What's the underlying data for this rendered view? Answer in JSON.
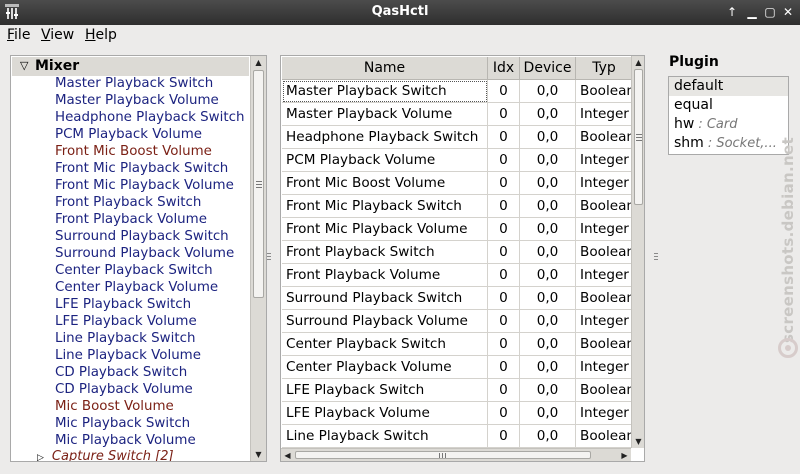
{
  "window": {
    "title": "QasHctl"
  },
  "menu": [
    {
      "mnemonic": "F",
      "rest": "ile"
    },
    {
      "mnemonic": "V",
      "rest": "iew"
    },
    {
      "mnemonic": "H",
      "rest": "elp"
    }
  ],
  "tree": {
    "root_label": "Mixer",
    "items": [
      {
        "label": "Master Playback Switch",
        "red": false
      },
      {
        "label": "Master Playback Volume",
        "red": false
      },
      {
        "label": "Headphone Playback Switch",
        "red": false
      },
      {
        "label": "PCM Playback Volume",
        "red": false
      },
      {
        "label": "Front Mic Boost Volume",
        "red": true
      },
      {
        "label": "Front Mic Playback Switch",
        "red": false
      },
      {
        "label": "Front Mic Playback Volume",
        "red": false
      },
      {
        "label": "Front Playback Switch",
        "red": false
      },
      {
        "label": "Front Playback Volume",
        "red": false
      },
      {
        "label": "Surround Playback Switch",
        "red": false
      },
      {
        "label": "Surround Playback Volume",
        "red": false
      },
      {
        "label": "Center Playback Switch",
        "red": false
      },
      {
        "label": "Center Playback Volume",
        "red": false
      },
      {
        "label": "LFE Playback Switch",
        "red": false
      },
      {
        "label": "LFE Playback Volume",
        "red": false
      },
      {
        "label": "Line Playback Switch",
        "red": false
      },
      {
        "label": "Line Playback Volume",
        "red": false
      },
      {
        "label": "CD Playback Switch",
        "red": false
      },
      {
        "label": "CD Playback Volume",
        "red": false
      },
      {
        "label": "Mic Boost Volume",
        "red": true
      },
      {
        "label": "Mic Playback Switch",
        "red": false
      },
      {
        "label": "Mic Playback Volume",
        "red": false
      }
    ],
    "collapsed_item": "Capture Switch [2]"
  },
  "table": {
    "headers": {
      "name": "Name",
      "idx": "Idx",
      "device": "Device",
      "type": "Typ"
    },
    "rows": [
      {
        "name": "Master Playback Switch",
        "idx": "0",
        "device": "0,0",
        "type": "Boolean"
      },
      {
        "name": "Master Playback Volume",
        "idx": "0",
        "device": "0,0",
        "type": "Integer"
      },
      {
        "name": "Headphone Playback Switch",
        "idx": "0",
        "device": "0,0",
        "type": "Boolean"
      },
      {
        "name": "PCM Playback Volume",
        "idx": "0",
        "device": "0,0",
        "type": "Integer"
      },
      {
        "name": "Front Mic Boost Volume",
        "idx": "0",
        "device": "0,0",
        "type": "Integer"
      },
      {
        "name": "Front Mic Playback Switch",
        "idx": "0",
        "device": "0,0",
        "type": "Boolean"
      },
      {
        "name": "Front Mic Playback Volume",
        "idx": "0",
        "device": "0,0",
        "type": "Integer"
      },
      {
        "name": "Front Playback Switch",
        "idx": "0",
        "device": "0,0",
        "type": "Boolean"
      },
      {
        "name": "Front Playback Volume",
        "idx": "0",
        "device": "0,0",
        "type": "Integer"
      },
      {
        "name": "Surround Playback Switch",
        "idx": "0",
        "device": "0,0",
        "type": "Boolean"
      },
      {
        "name": "Surround Playback Volume",
        "idx": "0",
        "device": "0,0",
        "type": "Integer"
      },
      {
        "name": "Center Playback Switch",
        "idx": "0",
        "device": "0,0",
        "type": "Boolean"
      },
      {
        "name": "Center Playback Volume",
        "idx": "0",
        "device": "0,0",
        "type": "Integer"
      },
      {
        "name": "LFE Playback Switch",
        "idx": "0",
        "device": "0,0",
        "type": "Boolean"
      },
      {
        "name": "LFE Playback Volume",
        "idx": "0",
        "device": "0,0",
        "type": "Integer"
      },
      {
        "name": "Line Playback Switch",
        "idx": "0",
        "device": "0,0",
        "type": "Boolean"
      }
    ]
  },
  "plugin": {
    "title": "Plugin",
    "items": [
      {
        "name": "default",
        "desc": "",
        "selected": true
      },
      {
        "name": "equal",
        "desc": "",
        "selected": false
      },
      {
        "name": "hw",
        "desc": ": Card",
        "selected": false
      },
      {
        "name": "shm",
        "desc": ": Socket,...",
        "selected": false
      }
    ]
  },
  "watermark": "screenshots.debian.net",
  "colors": {
    "tree_text": "#1c2380",
    "tree_text_alt": "#7a1f14",
    "titlebar": "#3a3a3a"
  }
}
